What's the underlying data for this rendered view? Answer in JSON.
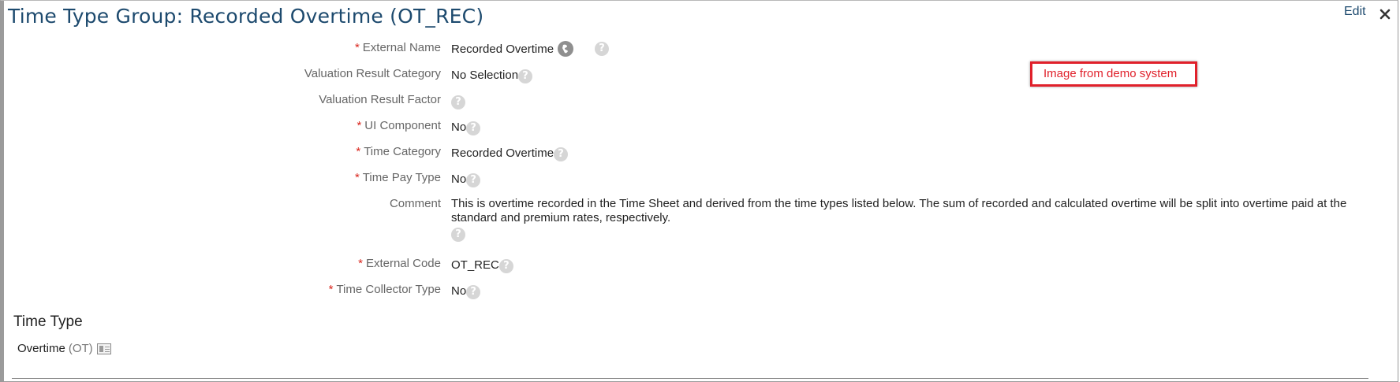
{
  "header": {
    "title": "Time Type Group: Recorded Overtime (OT_REC)",
    "edit_label": "Edit",
    "close_glyph": "✕"
  },
  "fields": {
    "external_name": {
      "label": "External Name",
      "required": "*",
      "value": "Recorded Overtime"
    },
    "valuation_result_category": {
      "label": "Valuation Result Category",
      "value": "No Selection"
    },
    "valuation_result_factor": {
      "label": "Valuation Result Factor",
      "value": ""
    },
    "ui_component": {
      "label": "UI Component",
      "required": "*",
      "value": "No"
    },
    "time_category": {
      "label": "Time Category",
      "required": "*",
      "value": "Recorded Overtime"
    },
    "time_pay_type": {
      "label": "Time Pay Type",
      "required": "*",
      "value": "No"
    },
    "comment": {
      "label": "Comment",
      "value": "This is overtime recorded in the Time Sheet and derived from the time types listed below. The sum of recorded and calculated overtime will be split into overtime paid at the standard and premium rates, respectively."
    },
    "external_code": {
      "label": "External Code",
      "required": "*",
      "value": "OT_REC"
    },
    "time_collector_type": {
      "label": "Time Collector Type",
      "required": "*",
      "value": "No"
    }
  },
  "help_glyph": "?",
  "annotation": {
    "text": "Image from demo system"
  },
  "time_type_section": {
    "title": "Time Type",
    "items": [
      {
        "name": "Overtime",
        "code": "(OT)"
      }
    ]
  },
  "icons": {
    "help": "help-circle-icon",
    "translate": "globe-icon",
    "detail": "detail-card-icon",
    "close": "close-icon"
  },
  "colors": {
    "title": "#1d4a6e",
    "required": "#d9251c",
    "annotation": "#e0202a"
  }
}
